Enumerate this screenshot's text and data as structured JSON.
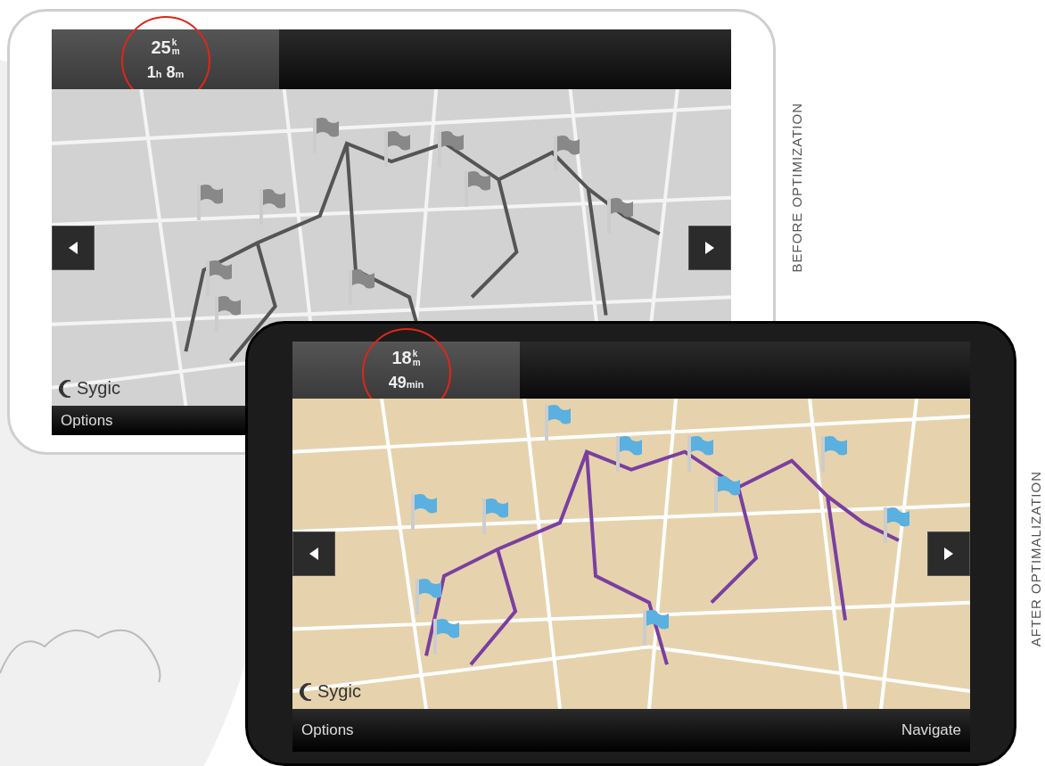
{
  "devices": [
    {
      "kind": "before",
      "distance": "25",
      "distance_unit": [
        "k",
        "m"
      ],
      "time": "1$_{h}$ 8$_{m}$",
      "logo": "Sygic",
      "buttons": [
        "Options"
      ],
      "caption": "BEFORE OPTIMIZATION"
    },
    {
      "kind": "after",
      "distance": "18",
      "distance_unit": [
        "k",
        "m"
      ],
      "time": "49$_{min}$",
      "logo": "Sygic",
      "buttons": [
        "Options",
        "Navigate"
      ],
      "caption": "AFTER OPTIMALIZATION"
    }
  ]
}
